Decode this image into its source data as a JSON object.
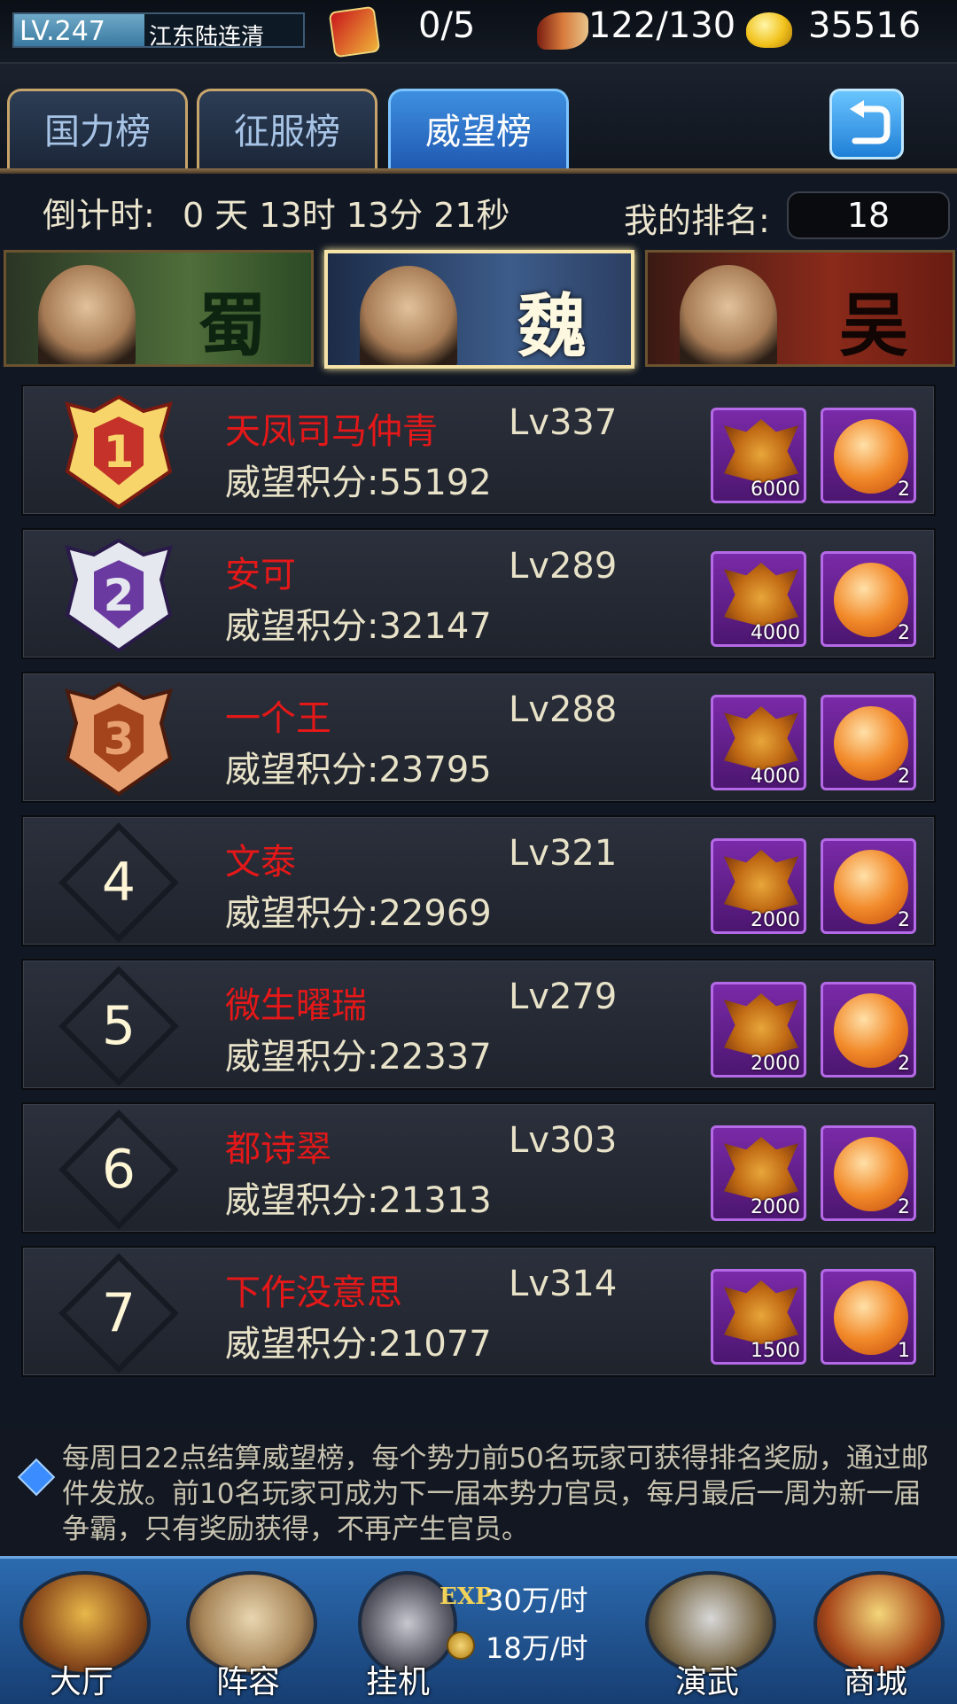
{
  "topbar": {
    "level": "LV.247",
    "player_name": "江东陆连清",
    "level_progress": 0.45,
    "order": {
      "icon": "order-token-icon",
      "value": "0/5"
    },
    "stamina": {
      "icon": "war-horn-icon",
      "value": "122/130"
    },
    "gold": {
      "icon": "gold-ingot-icon",
      "value": "35516"
    }
  },
  "tabs": [
    {
      "label": "国力榜",
      "active": false
    },
    {
      "label": "征服榜",
      "active": false
    },
    {
      "label": "威望榜",
      "active": true
    }
  ],
  "back_button": {
    "icon": "return-arrow-icon"
  },
  "countdown": {
    "label": "倒计时:",
    "value": "0 天 13时 13分 21秒"
  },
  "my_rank": {
    "label": "我的排名:",
    "value": "18"
  },
  "factions": [
    {
      "char": "蜀",
      "active": false
    },
    {
      "char": "魏",
      "active": true
    },
    {
      "char": "吴",
      "active": false
    }
  ],
  "ranking": [
    {
      "rank": "1",
      "badge": "gold-medal-icon",
      "name": "天凤司马仲青",
      "level": "Lv337",
      "score_label": "威望积分:",
      "score": "55192",
      "rewards": [
        "6000",
        "2"
      ]
    },
    {
      "rank": "2",
      "badge": "silver-medal-icon",
      "name": "安可",
      "level": "Lv289",
      "score_label": "威望积分:",
      "score": "32147",
      "rewards": [
        "4000",
        "2"
      ]
    },
    {
      "rank": "3",
      "badge": "bronze-medal-icon",
      "name": "一个王",
      "level": "Lv288",
      "score_label": "威望积分:",
      "score": "23795",
      "rewards": [
        "4000",
        "2"
      ]
    },
    {
      "rank": "4",
      "name": "文泰",
      "level": "Lv321",
      "score_label": "威望积分:",
      "score": "22969",
      "rewards": [
        "2000",
        "2"
      ]
    },
    {
      "rank": "5",
      "name": "微生曜瑞",
      "level": "Lv279",
      "score_label": "威望积分:",
      "score": "22337",
      "rewards": [
        "2000",
        "2"
      ]
    },
    {
      "rank": "6",
      "name": "都诗翠",
      "level": "Lv303",
      "score_label": "威望积分:",
      "score": "21313",
      "rewards": [
        "2000",
        "2"
      ]
    },
    {
      "rank": "7",
      "name": "下作没意思",
      "level": "Lv314",
      "score_label": "威望积分:",
      "score": "21077",
      "rewards": [
        "1500",
        "1"
      ]
    }
  ],
  "reward_icons": [
    "prestige-crest-icon",
    "dragon-orb-icon"
  ],
  "notice": {
    "icon": "blue-diamond-icon",
    "text": "每周日22点结算威望榜，每个势力前50名玩家可获得排名奖励，通过邮件发放。前10名玩家可成为下一届本势力官员，每月最后一周为新一届争霸，只有奖励获得，不再产生官员。"
  },
  "bottom_nav": {
    "hall": "大厅",
    "lineup": "阵容",
    "idle": "挂机",
    "exp_label": "EXP",
    "exp_rate": "30万/时",
    "coin_rate": "18万/时",
    "arena": "演武",
    "shop": "商城"
  },
  "colors": {
    "player_name": "#e41818",
    "active_tab": "#2f7ad0",
    "reward_frame": "#b46ae6"
  }
}
